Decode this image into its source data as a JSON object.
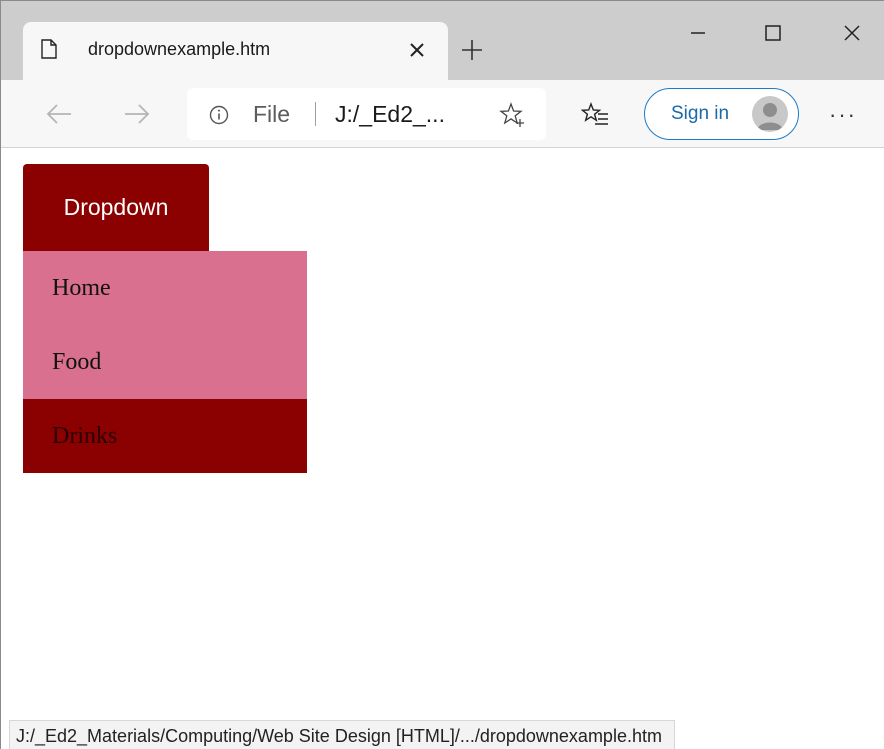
{
  "browser": {
    "tab_title": "dropdownexample.htm",
    "address_scheme": "File",
    "address_url": "J:/_Ed2_...",
    "sign_in_label": "Sign in",
    "more_label": "···"
  },
  "page": {
    "dropdown_button_label": "Dropdown",
    "menu_items": [
      {
        "label": "Home"
      },
      {
        "label": "Food"
      },
      {
        "label": "Drinks"
      }
    ],
    "hovered_item": "Drinks",
    "colors": {
      "button_bg": "#8b0000",
      "menu_bg": "#d97090",
      "hover_bg": "#8b0000"
    }
  },
  "status_bar": {
    "link_url": "J:/_Ed2_Materials/Computing/Web Site Design [HTML]/.../dropdownexample.htm"
  }
}
